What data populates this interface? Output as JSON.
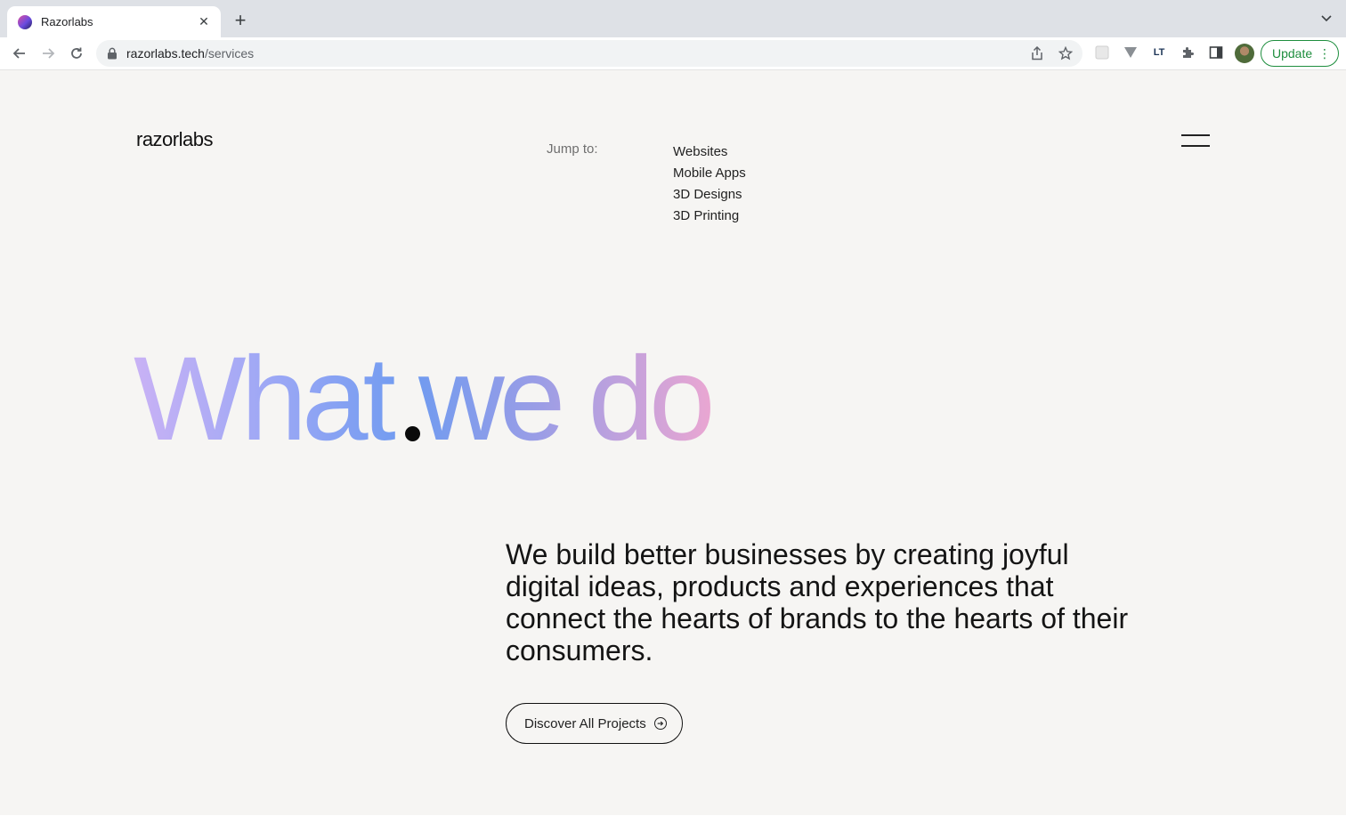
{
  "browser": {
    "tab_title": "Razorlabs",
    "url_domain": "razorlabs.tech",
    "url_path": "/services",
    "update_label": "Update",
    "icons": {
      "close_tab": "close-icon",
      "new_tab": "plus-icon",
      "back": "arrow-left-icon",
      "forward": "arrow-right-icon",
      "reload": "reload-icon",
      "lock": "lock-icon",
      "share": "share-icon",
      "bookmark": "star-icon",
      "extensions": "puzzle-icon",
      "side_panel": "side-panel-icon",
      "menu": "kebab-menu-icon"
    }
  },
  "site": {
    "logo_bold": "razor",
    "logo_light": "labs",
    "jump_label": "Jump to:",
    "jump_links": [
      "Websites",
      "Mobile Apps",
      "3D Designs",
      "3D Printing"
    ],
    "hero_title": "What we do",
    "tagline": "We build better businesses by creating joyful digital ideas, products and experiences that connect the hearts of brands to the hearts of their consumers.",
    "cta_label": "Discover All Projects"
  },
  "colors": {
    "page_bg": "#f6f5f3",
    "hero_gradient": [
      "#c9b2f5",
      "#9aa7f5",
      "#6f9bf0",
      "#9a9de6",
      "#e9a6d2"
    ],
    "update_green": "#1e8e3e"
  }
}
